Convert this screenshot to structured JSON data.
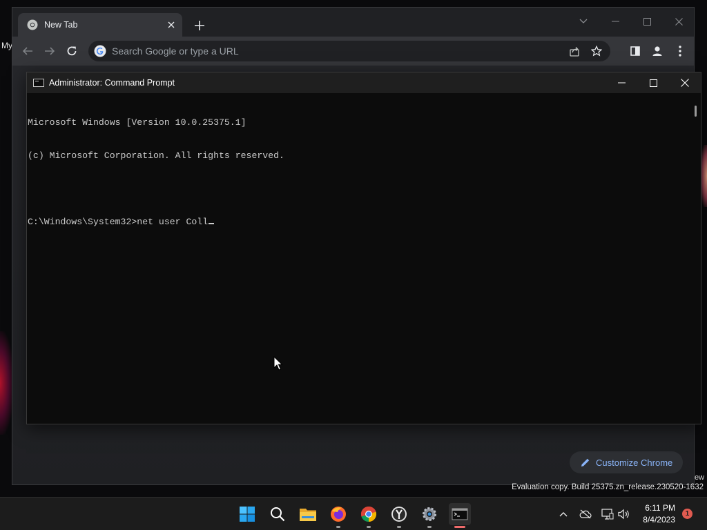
{
  "desktop": {
    "partial_text_left": "My",
    "partial_text_right": "ew",
    "watermark": "Evaluation copy. Build 25375.zn_release.230520-1632"
  },
  "chrome": {
    "tab_title": "New Tab",
    "omnibox_placeholder": "Search Google or type a URL",
    "customize_label": "Customize Chrome",
    "accent_color": "#8ab4f8"
  },
  "cmd": {
    "title": "Administrator: Command Prompt",
    "lines": [
      "Microsoft Windows [Version 10.0.25375.1]",
      "(c) Microsoft Corporation. All rights reserved.",
      "",
      "C:\\Windows\\System32>net user Coll"
    ]
  },
  "taskbar": {
    "apps": [
      {
        "name": "start-button",
        "icon": "windows-logo-icon"
      },
      {
        "name": "search-button",
        "icon": "search-icon"
      },
      {
        "name": "file-explorer-app",
        "icon": "folder-icon"
      },
      {
        "name": "firefox-app",
        "icon": "firefox-icon"
      },
      {
        "name": "chrome-app",
        "icon": "chrome-icon"
      },
      {
        "name": "yandex-app",
        "icon": "yandex-icon"
      },
      {
        "name": "settings-app",
        "icon": "gear-icon"
      },
      {
        "name": "terminal-app",
        "icon": "terminal-icon"
      }
    ],
    "clock_time": "6:11 PM",
    "clock_date": "8/4/2023",
    "notification_count": "1"
  }
}
